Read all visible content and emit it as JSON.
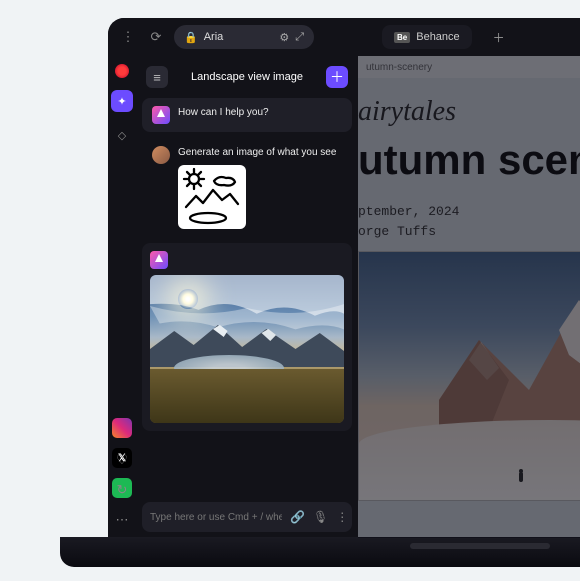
{
  "topbar": {
    "address_label": "Aria",
    "tab": {
      "badge": "Be",
      "label": "Behance"
    }
  },
  "aria": {
    "conversation_title": "Landscape view image",
    "greeting": "How can I help you?",
    "user_prompt": "Generate an image of what you see",
    "input_placeholder": "Type here or use Cmd + / when browsing"
  },
  "page": {
    "url_fragment": "utumn-scenery",
    "subtitle_fragment": "airytales",
    "title_fragment": "utumn scenery",
    "date_fragment": "ptember, 2024",
    "author_fragment": "orge Tuffs"
  }
}
